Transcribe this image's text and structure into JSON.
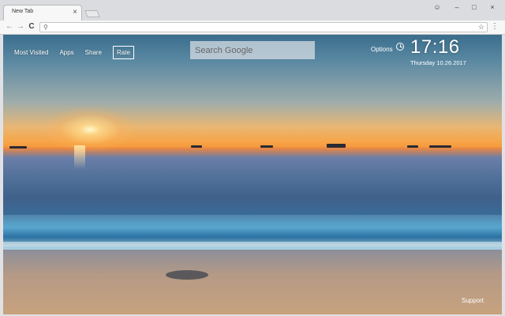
{
  "browser": {
    "tab_title": "New Tab",
    "tab_close": "×",
    "window_controls": {
      "account": "☺",
      "minimize": "–",
      "maximize": "□",
      "close": "×"
    },
    "nav": {
      "back": "←",
      "forward": "→",
      "reload": "C"
    },
    "omnibox": {
      "search_icon": "⚲",
      "value": ""
    },
    "bookmark_star": "☆",
    "menu": "⋮"
  },
  "page": {
    "links": {
      "most_visited": "Most Visited",
      "apps": "Apps",
      "share": "Share",
      "rate": "Rate"
    },
    "search": {
      "placeholder": "Search Google"
    },
    "options_label": "Options",
    "clock": {
      "time": "17:16",
      "date": "Thursday 10.26.2017"
    },
    "support_label": "Support"
  },
  "colors": {
    "text_on_image": "#ffffff",
    "search_box": "#dce1e8"
  }
}
